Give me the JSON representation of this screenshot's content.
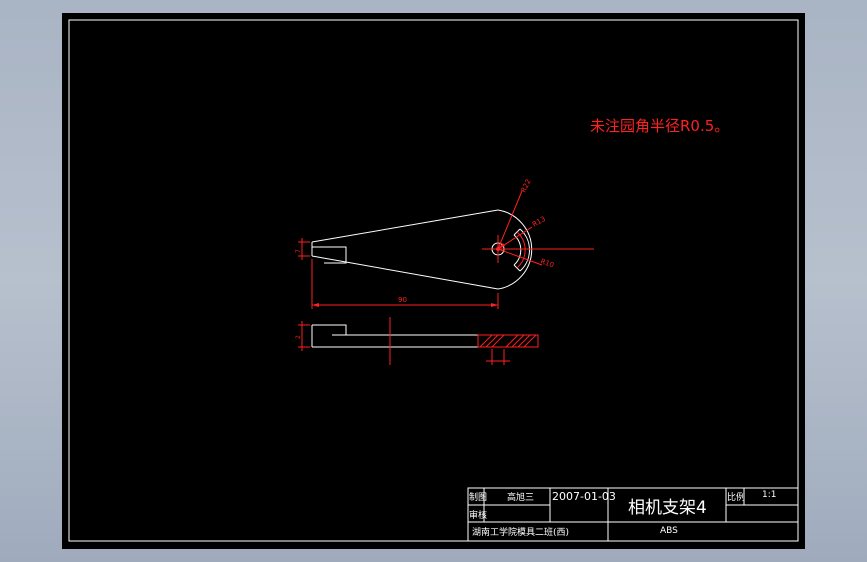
{
  "drawing": {
    "note": "未注园角半径R0.5。"
  },
  "dimensions": {
    "overall_length": "90",
    "radius_1": "R22",
    "radius_2": "R13",
    "radius_3": "R10",
    "left_height": "7",
    "thickness": "2"
  },
  "title_block": {
    "drawn_label": "制图",
    "drawn_name": "高旭三",
    "date": "2007-01-03",
    "check_label": "审核",
    "part_name": "相机支架4",
    "scale_label": "比例",
    "scale_value": "1:1",
    "material": "ABS",
    "school": "湖南工学院模具二班(西)"
  },
  "colors": {
    "sheet_background": "#000000",
    "outline": "#ffffff",
    "dimension": "#ff2020",
    "app_background": "#b0bac8"
  }
}
